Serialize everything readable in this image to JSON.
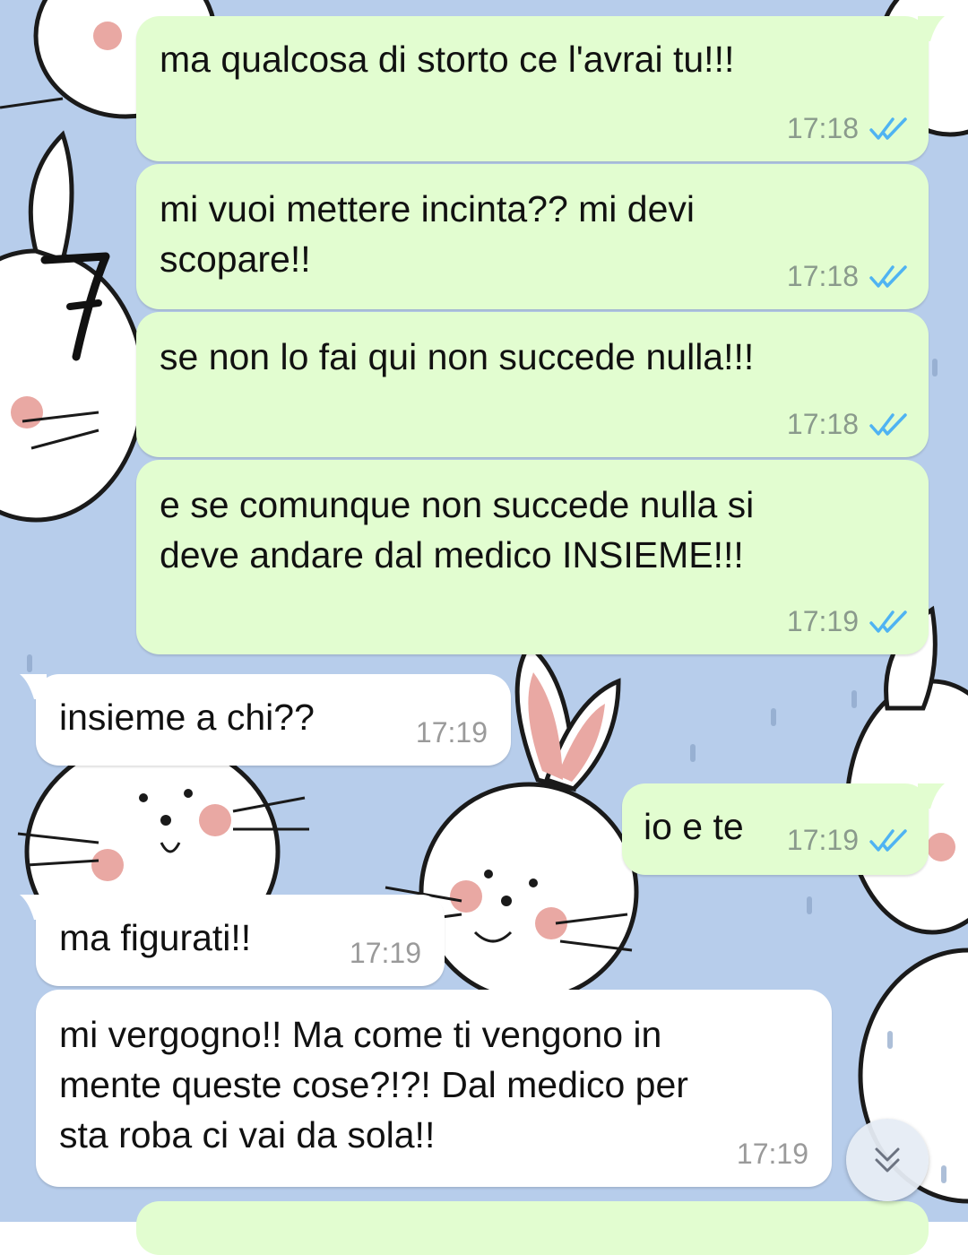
{
  "chat": {
    "messages": [
      {
        "direction": "out",
        "text": "ma qualcosa di storto ce l'avrai tu!!!",
        "time": "17:18",
        "status": "read"
      },
      {
        "direction": "out",
        "text": "mi vuoi mettere incinta?? mi devi\nscopare!!",
        "time": "17:18",
        "status": "read"
      },
      {
        "direction": "out",
        "text": "se non lo fai qui non succede nulla!!!",
        "time": "17:18",
        "status": "read"
      },
      {
        "direction": "out",
        "text": "e se comunque non succede nulla si\ndeve andare dal medico INSIEME!!!",
        "time": "17:19",
        "status": "read"
      },
      {
        "direction": "in",
        "text": "insieme a chi??",
        "time": "17:19"
      },
      {
        "direction": "out",
        "text": "io e te",
        "time": "17:19",
        "status": "read"
      },
      {
        "direction": "in",
        "text": "ma figurati!!",
        "time": "17:19"
      },
      {
        "direction": "in",
        "text": "mi vergogno!! Ma come ti vengono in\nmente queste cose?!?! Dal medico per\nsta roba ci vai da sola!!",
        "time": "17:19"
      }
    ]
  },
  "annotation": {
    "number": "7"
  },
  "icons": {
    "read_receipt": "double-check-icon",
    "scroll_down": "chevrons-down-icon"
  },
  "colors": {
    "wallpaper": "#b7cdeb",
    "outgoing_bubble": "#e2fdd0",
    "incoming_bubble": "#ffffff",
    "read_tick": "#4fb3f2"
  }
}
